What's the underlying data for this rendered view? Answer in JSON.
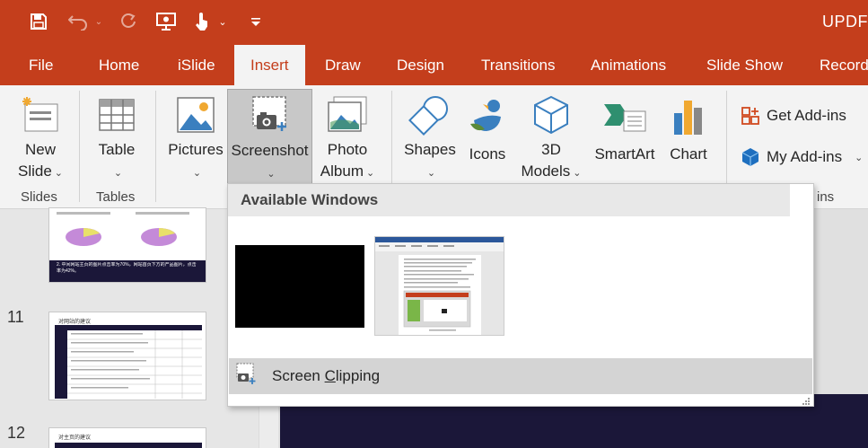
{
  "titlebar": {
    "app_title": "UPDF",
    "quick_access": [
      "save-icon",
      "undo-icon",
      "redo-icon",
      "from-beginning-icon",
      "touch-mode-icon",
      "customize-icon"
    ]
  },
  "tabs": [
    {
      "label": "File"
    },
    {
      "label": "Home"
    },
    {
      "label": "iSlide"
    },
    {
      "label": "Insert"
    },
    {
      "label": "Draw"
    },
    {
      "label": "Design"
    },
    {
      "label": "Transitions"
    },
    {
      "label": "Animations"
    },
    {
      "label": "Slide Show"
    },
    {
      "label": "Record"
    }
  ],
  "ribbon": {
    "new_slide": {
      "line1": "New",
      "line2": "Slide"
    },
    "table": "Table",
    "pictures": "Pictures",
    "screenshot": "Screenshot",
    "photo_album": {
      "line1": "Photo",
      "line2": "Album"
    },
    "shapes": "Shapes",
    "icons": "Icons",
    "models_3d": {
      "line1": "3D",
      "line2": "Models"
    },
    "smartart": "SmartArt",
    "chart": "Chart",
    "get_addins": "Get Add-ins",
    "my_addins": "My Add-ins",
    "groups": {
      "slides": "Slides",
      "tables": "Tables",
      "addins_partial": "ins"
    }
  },
  "slides_pane": {
    "numbers": [
      "11",
      "12"
    ],
    "slide10_caption": "2. 中间网站主页的图片点击率为70%，网站首页下方的产品图片，点击率为42%。",
    "slide11_title": "对网站的建议",
    "slide12_title": "对主页的建议"
  },
  "dropdown": {
    "header": "Available Windows",
    "screen_clipping_pre": "Screen ",
    "screen_clipping_key": "C",
    "screen_clipping_post": "lipping"
  },
  "colors": {
    "accent": "#c43e1c",
    "ribbon_bg": "#f3f3f3",
    "pressed_bg": "#c8c8c8",
    "slide_bg": "#1b1739"
  }
}
